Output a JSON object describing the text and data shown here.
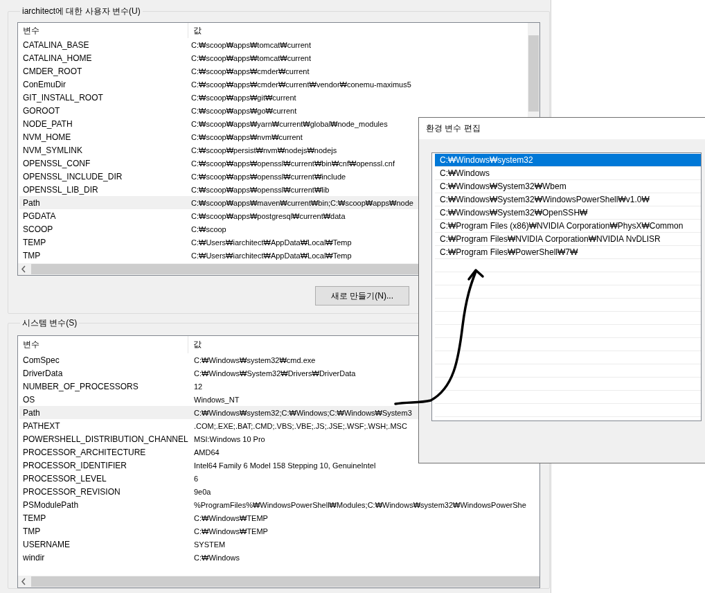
{
  "user_variables": {
    "title": "iarchitect에 대한 사용자 변수(U)",
    "columns": [
      "변수",
      "값"
    ],
    "rows": [
      {
        "name": "CATALINA_BASE",
        "value": "C:₩scoop₩apps₩tomcat₩current",
        "selected": false
      },
      {
        "name": "CATALINA_HOME",
        "value": "C:₩scoop₩apps₩tomcat₩current",
        "selected": false
      },
      {
        "name": "CMDER_ROOT",
        "value": "C:₩scoop₩apps₩cmder₩current",
        "selected": false
      },
      {
        "name": "ConEmuDir",
        "value": "C:₩scoop₩apps₩cmder₩current₩vendor₩conemu-maximus5",
        "selected": false
      },
      {
        "name": "GIT_INSTALL_ROOT",
        "value": "C:₩scoop₩apps₩git₩current",
        "selected": false
      },
      {
        "name": "GOROOT",
        "value": "C:₩scoop₩apps₩go₩current",
        "selected": false
      },
      {
        "name": "NODE_PATH",
        "value": "C:₩scoop₩apps₩yarn₩current₩global₩node_modules",
        "selected": false
      },
      {
        "name": "NVM_HOME",
        "value": "C:₩scoop₩apps₩nvm₩current",
        "selected": false
      },
      {
        "name": "NVM_SYMLINK",
        "value": "C:₩scoop₩persist₩nvm₩nodejs₩nodejs",
        "selected": false
      },
      {
        "name": "OPENSSL_CONF",
        "value": "C:₩scoop₩apps₩openssl₩current₩bin₩cnf₩openssl.cnf",
        "selected": false
      },
      {
        "name": "OPENSSL_INCLUDE_DIR",
        "value": "C:₩scoop₩apps₩openssl₩current₩include",
        "selected": false
      },
      {
        "name": "OPENSSL_LIB_DIR",
        "value": "C:₩scoop₩apps₩openssl₩current₩lib",
        "selected": false
      },
      {
        "name": "Path",
        "value": "C:₩scoop₩apps₩maven₩current₩bin;C:₩scoop₩apps₩node",
        "selected": true
      },
      {
        "name": "PGDATA",
        "value": "C:₩scoop₩apps₩postgresql₩current₩data",
        "selected": false
      },
      {
        "name": "SCOOP",
        "value": "C:₩scoop",
        "selected": false
      },
      {
        "name": "TEMP",
        "value": "C:₩Users₩iarchitect₩AppData₩Local₩Temp",
        "selected": false
      },
      {
        "name": "TMP",
        "value": "C:₩Users₩iarchitect₩AppData₩Local₩Temp",
        "selected": false
      }
    ],
    "buttons": [
      "새로 만들기(N)..."
    ]
  },
  "system_variables": {
    "title": "시스템 변수(S)",
    "columns": [
      "변수",
      "값"
    ],
    "rows": [
      {
        "name": "ComSpec",
        "value": "C:₩Windows₩system32₩cmd.exe",
        "selected": false
      },
      {
        "name": "DriverData",
        "value": "C:₩Windows₩System32₩Drivers₩DriverData",
        "selected": false
      },
      {
        "name": "NUMBER_OF_PROCESSORS",
        "value": "12",
        "selected": false
      },
      {
        "name": "OS",
        "value": "Windows_NT",
        "selected": false
      },
      {
        "name": "Path",
        "value": "C:₩Windows₩system32;C:₩Windows;C:₩Windows₩System3",
        "selected": true
      },
      {
        "name": "PATHEXT",
        "value": ".COM;.EXE;.BAT;.CMD;.VBS;.VBE;.JS;.JSE;.WSF;.WSH;.MSC",
        "selected": false
      },
      {
        "name": "POWERSHELL_DISTRIBUTION_CHANNEL",
        "value": "MSI:Windows 10 Pro",
        "selected": false
      },
      {
        "name": "PROCESSOR_ARCHITECTURE",
        "value": "AMD64",
        "selected": false
      },
      {
        "name": "PROCESSOR_IDENTIFIER",
        "value": "Intel64 Family 6 Model 158 Stepping 10, GenuineIntel",
        "selected": false
      },
      {
        "name": "PROCESSOR_LEVEL",
        "value": "6",
        "selected": false
      },
      {
        "name": "PROCESSOR_REVISION",
        "value": "9e0a",
        "selected": false
      },
      {
        "name": "PSModulePath",
        "value": "%ProgramFiles%₩WindowsPowerShell₩Modules;C:₩Windows₩system32₩WindowsPowerShe",
        "selected": false
      },
      {
        "name": "TEMP",
        "value": "C:₩Windows₩TEMP",
        "selected": false
      },
      {
        "name": "TMP",
        "value": "C:₩Windows₩TEMP",
        "selected": false
      },
      {
        "name": "USERNAME",
        "value": "SYSTEM",
        "selected": false
      },
      {
        "name": "windir",
        "value": "C:₩Windows",
        "selected": false
      }
    ]
  },
  "edit_dialog": {
    "title": "환경 변수 편집",
    "entries": [
      {
        "text": "C:₩Windows₩system32",
        "selected": true
      },
      {
        "text": "C:₩Windows",
        "selected": false
      },
      {
        "text": "C:₩Windows₩System32₩Wbem",
        "selected": false
      },
      {
        "text": "C:₩Windows₩System32₩WindowsPowerShell₩v1.0₩",
        "selected": false
      },
      {
        "text": "C:₩Windows₩System32₩OpenSSH₩",
        "selected": false
      },
      {
        "text": "C:₩Program Files (x86)₩NVIDIA Corporation₩PhysX₩Common",
        "selected": false
      },
      {
        "text": "C:₩Program Files₩NVIDIA Corporation₩NVIDIA NvDLISR",
        "selected": false
      },
      {
        "text": "C:₩Program Files₩PowerShell₩7₩",
        "selected": false
      }
    ]
  }
}
